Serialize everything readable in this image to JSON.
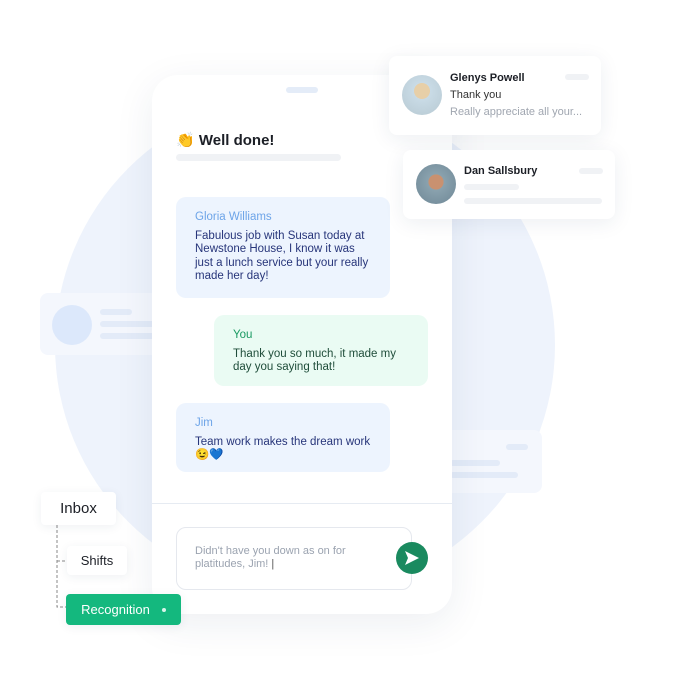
{
  "colors": {
    "accent": "#14b87e",
    "send": "#1a8a5f",
    "background_circle": "#eef3fc"
  },
  "chat": {
    "title_icon": "clapping-hands-icon",
    "title": "Well done!",
    "messages": [
      {
        "sender": "Gloria Williams",
        "text": "Fabulous job with Susan today at Newstone House, I know it was just a lunch service but your really made her day!"
      },
      {
        "sender": "You",
        "text": "Thank you so much, it made my day you saying that!"
      },
      {
        "sender": "Jim",
        "text": "Team work makes the dream work 😉💙"
      }
    ],
    "input_value": "Didn't have you down as on for platitudes, Jim!",
    "send_icon": "send-icon"
  },
  "notifications": [
    {
      "name": "Glenys Powell",
      "line1": "Thank you",
      "line2": "Really appreciate all your..."
    },
    {
      "name": "Dan Sallsbury"
    }
  ],
  "nav": {
    "inbox": "Inbox",
    "shifts": "Shifts",
    "recognition": "Recognition"
  }
}
